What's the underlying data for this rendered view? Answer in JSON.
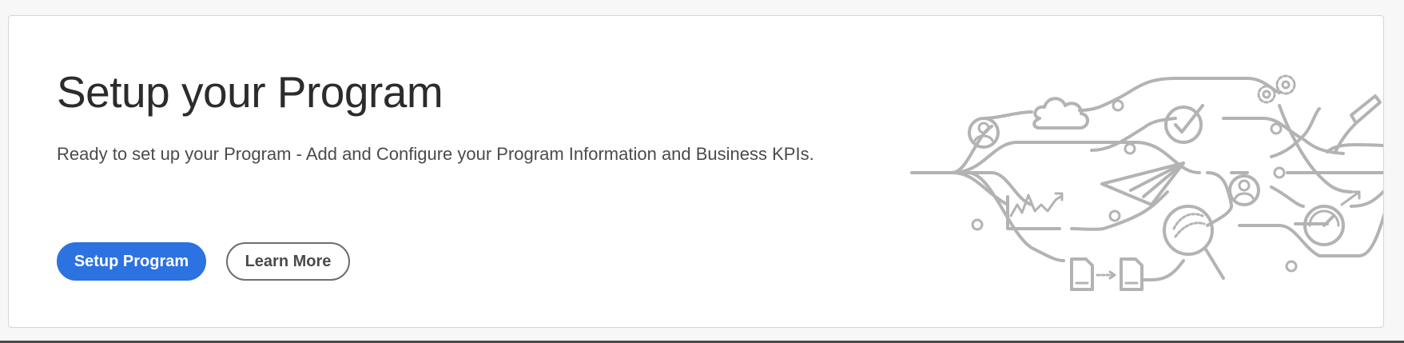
{
  "banner": {
    "title": "Setup your Program",
    "description": "Ready to set up your Program - Add and Configure your Program Information and Business KPIs.",
    "primary_button_label": "Setup Program",
    "secondary_button_label": "Learn More"
  },
  "colors": {
    "primary": "#2c72e0",
    "illustration": "#b3b3b3",
    "title_text": "#2c2c2c",
    "body_text": "#4b4b4b"
  },
  "illustration_icons": [
    "user-icon",
    "cloud-icon",
    "checkmark-icon",
    "gears-icon",
    "pen-icon",
    "line-chart-icon",
    "paper-plane-icon",
    "magnifier-icon",
    "gauge-icon",
    "document-icon"
  ]
}
